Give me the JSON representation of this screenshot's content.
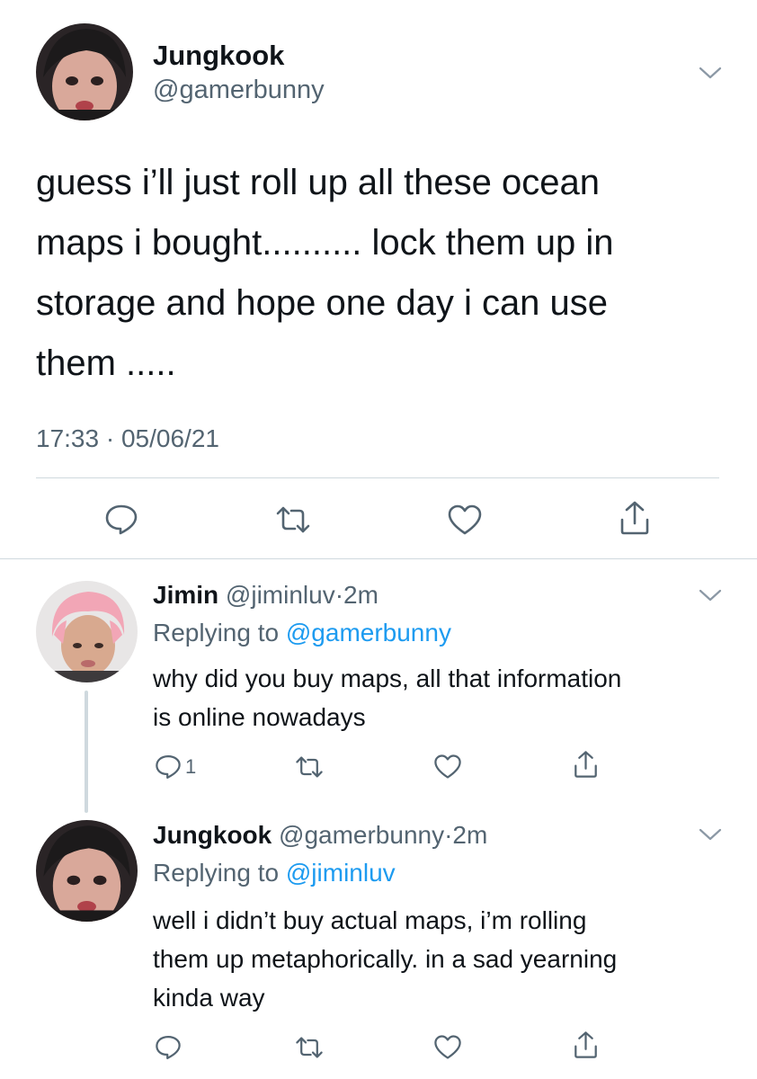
{
  "main_tweet": {
    "name": "Jungkook",
    "handle": "@gamerbunny",
    "text_lines": [
      "guess i’ll just roll up all these ocean",
      "maps i bought.......... lock them up in",
      "storage and hope one day i can use",
      "them ....."
    ],
    "time": "17:33",
    "separator": "·",
    "date": "05/06/21",
    "icons": [
      "reply-icon",
      "retweet-icon",
      "like-icon",
      "share-icon",
      "chevron-down-icon"
    ]
  },
  "replies": [
    {
      "name": "Jimin",
      "handle": "@jiminluv",
      "separator": "·",
      "time": "2m",
      "replying_prefix": "Replying to",
      "replying_to": "@gamerbunny",
      "text_lines": [
        "why did you buy maps, all that information",
        "is online nowadays"
      ],
      "reply_count": "1"
    },
    {
      "name": "Jungkook",
      "handle": "@gamerbunny",
      "separator": "·",
      "time": "2m",
      "replying_prefix": "Replying to",
      "replying_to": "@jiminluv",
      "text_lines": [
        "well i didn’t buy actual maps, i’m rolling",
        "them up metaphorically. in a sad yearning",
        "kinda way"
      ]
    }
  ],
  "colors": {
    "text": "#0f1419",
    "secondary": "#536471",
    "link": "#1d9bf0",
    "divider": "#cfd9de",
    "jimin_hair": "#f2a6b6"
  }
}
